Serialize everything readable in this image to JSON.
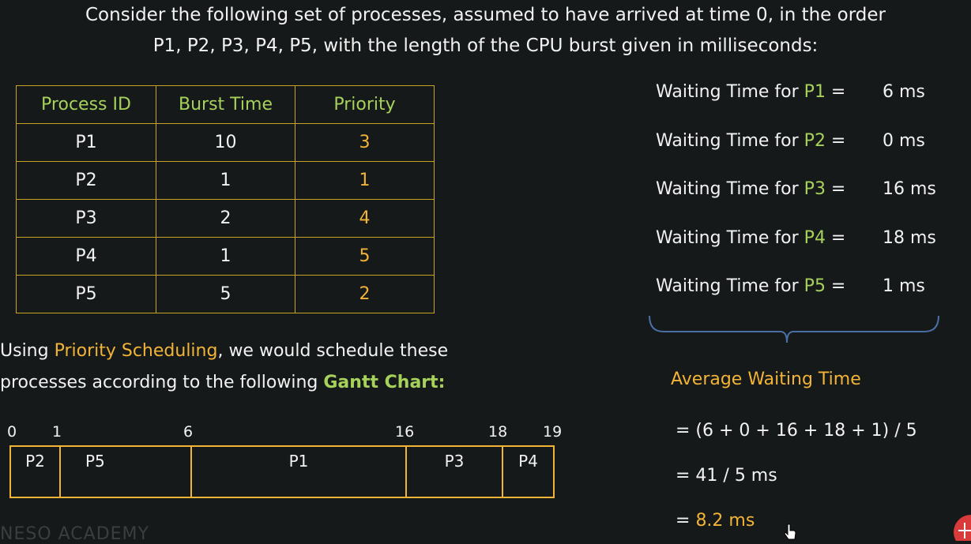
{
  "intro": {
    "line1": "Consider the following set of processes, assumed to have arrived at time 0, in the order",
    "line2": "P1, P2, P3, P4, P5, with the length of the CPU burst given in milliseconds:"
  },
  "table": {
    "headers": [
      "Process ID",
      "Burst Time",
      "Priority"
    ],
    "rows": [
      {
        "pid": "P1",
        "burst": "10",
        "priority": "3"
      },
      {
        "pid": "P2",
        "burst": "1",
        "priority": "1"
      },
      {
        "pid": "P3",
        "burst": "2",
        "priority": "4"
      },
      {
        "pid": "P4",
        "burst": "1",
        "priority": "5"
      },
      {
        "pid": "P5",
        "burst": "5",
        "priority": "2"
      }
    ]
  },
  "waiting": {
    "prefix": "Waiting Time for",
    "rows": [
      {
        "pid": "P1",
        "value": "6 ms"
      },
      {
        "pid": "P2",
        "value": "0 ms"
      },
      {
        "pid": "P3",
        "value": "16 ms"
      },
      {
        "pid": "P4",
        "value": "18 ms"
      },
      {
        "pid": "P5",
        "value": "1 ms"
      }
    ]
  },
  "average": {
    "title": "Average Waiting Time",
    "step1": "= (6 + 0 + 16 + 18 + 1) / 5",
    "step2": "= 41 / 5 ms",
    "step3_prefix": "= ",
    "step3_value": "8.2 ms"
  },
  "schedule_text": {
    "line1_a": "Using ",
    "line1_b": "Priority Scheduling",
    "line1_c": ", we would schedule these",
    "line2_a": " processes according to the following ",
    "line2_b": "Gantt Chart:"
  },
  "gantt": {
    "ticks": [
      "0",
      "1",
      "6",
      "16",
      "18",
      "19"
    ],
    "segments": [
      {
        "label": "P2",
        "start": 0,
        "end": 1
      },
      {
        "label": "P5",
        "start": 1,
        "end": 6
      },
      {
        "label": "P1",
        "start": 6,
        "end": 16
      },
      {
        "label": "P3",
        "start": 16,
        "end": 18
      },
      {
        "label": "P4",
        "start": 18,
        "end": 19
      }
    ]
  },
  "watermark": "NESO ACADEMY",
  "colors": {
    "accent_yellow": "#f2b437",
    "accent_green": "#a6d15a",
    "background": "#16191a"
  }
}
